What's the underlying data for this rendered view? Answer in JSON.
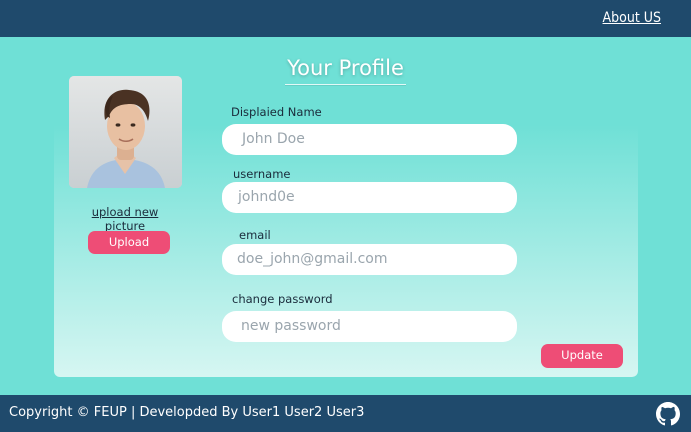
{
  "header": {
    "about_label": "About US"
  },
  "page": {
    "title": "Your Profile"
  },
  "profile": {
    "upload_link": "upload new picture",
    "upload_button": "Upload"
  },
  "form": {
    "display_name": {
      "label": "Displaied Name",
      "placeholder": "John Doe"
    },
    "username": {
      "label": "username",
      "placeholder": "johnd0e"
    },
    "email": {
      "label": "email",
      "placeholder": "doe_john@gmail.com"
    },
    "password": {
      "label": "change password",
      "placeholder": "new password"
    },
    "update_button": "Update"
  },
  "footer": {
    "text": "Copyright © FEUP | Developded By User1 User2 User3",
    "icon": "github-icon"
  },
  "colors": {
    "topbar": "#1f4a6c",
    "background": "#6fe0d6",
    "accent_button": "#ee4d76"
  }
}
